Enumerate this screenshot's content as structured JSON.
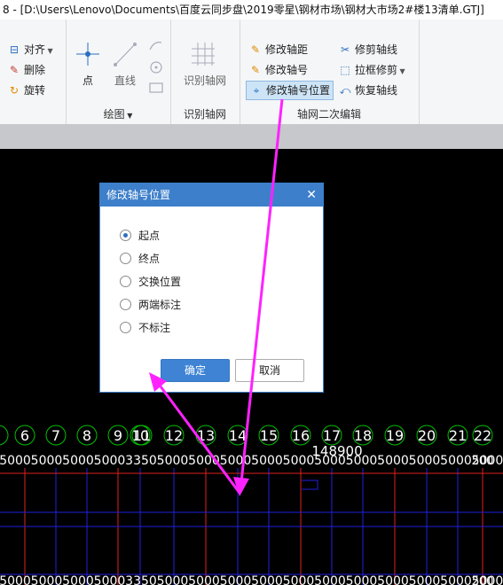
{
  "window": {
    "title": "8 - [D:\\Users\\Lenovo\\Documents\\百度云同步盘\\2019零星\\钢材市场\\钢材大市场2#楼13清单.GTJ]"
  },
  "ribbon": {
    "edit": {
      "align": "对齐",
      "delete": "删除",
      "rotate": "旋转"
    },
    "draw": {
      "point": "点",
      "line": "直线",
      "label": "绘图"
    },
    "recognize": {
      "button": "识别轴网",
      "label": "识别轴网"
    },
    "secondary": {
      "modify_spacing": "修改轴距",
      "modify_number": "修改轴号",
      "modify_number_position": "修改轴号位置",
      "trim_axis": "修剪轴线",
      "box_trim": "拉框修剪",
      "restore_axis": "恢复轴线",
      "label": "轴网二次编辑"
    }
  },
  "dialog": {
    "title": "修改轴号位置",
    "options": [
      {
        "label": "起点",
        "selected": true
      },
      {
        "label": "终点",
        "selected": false
      },
      {
        "label": "交换位置",
        "selected": false
      },
      {
        "label": "两端标注",
        "selected": false
      },
      {
        "label": "不标注",
        "selected": false
      }
    ],
    "ok": "确定",
    "cancel": "取消"
  },
  "canvas": {
    "axis_numbers": [
      "6",
      "7",
      "8",
      "9",
      "10",
      "11",
      "12",
      "13",
      "14",
      "15",
      "16",
      "17",
      "18",
      "19",
      "20",
      "21",
      "22"
    ],
    "total_dimension": "148900",
    "dimension_value": "5000",
    "partial_dimension": "3350",
    "edge_dimension": "200",
    "colors": {
      "axis_circle": "#00c000",
      "grid_red": "#e02020",
      "grid_blue": "#2020e0",
      "arrow": "#ff22ff"
    }
  }
}
